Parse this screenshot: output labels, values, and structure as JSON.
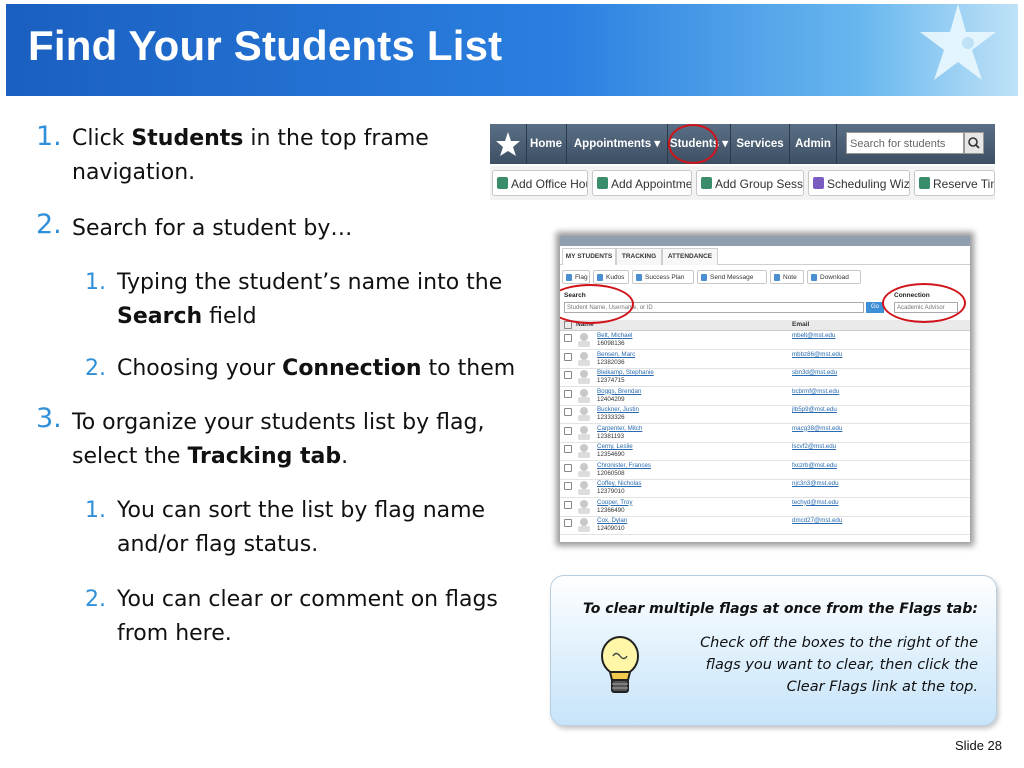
{
  "slide": {
    "title": "Find Your Students List",
    "number_label": "Slide 28"
  },
  "bullets": [
    {
      "num": "1.",
      "pre": "Click ",
      "bold": "Students",
      "post": " in the top frame",
      "line2": "navigation."
    },
    {
      "num": "2.",
      "text": "Search for a student by…"
    },
    {
      "num": "1.",
      "text": "Typing the student’s name into the",
      "bold": "Search",
      "post": " field"
    },
    {
      "num": "2.",
      "pre": "Choosing your ",
      "bold": "Connection",
      "post": " to them"
    },
    {
      "num": "3.",
      "text": "To organize your students list by flag,",
      "pre2": "select the ",
      "bold": "Tracking tab",
      "post": "."
    },
    {
      "num": "1.",
      "text": "You can sort the list by flag name",
      "line2": "and/or flag status."
    },
    {
      "num": "2.",
      "text": "You can clear or comment on flags",
      "line2": "from here."
    }
  ],
  "nav_screenshot": {
    "menu": [
      {
        "label": "Home"
      },
      {
        "label": "Appointments ▾"
      },
      {
        "label": "Students ▾"
      },
      {
        "label": "Services"
      },
      {
        "label": "Admin"
      }
    ],
    "search_placeholder": "Search for students",
    "toolbar": [
      {
        "label": "Add Office Hours"
      },
      {
        "label": "Add Appointment"
      },
      {
        "label": "Add Group Session"
      },
      {
        "label": "Scheduling Wizard"
      },
      {
        "label": "Reserve Time"
      }
    ]
  },
  "students_screenshot": {
    "tabs": [
      "MY STUDENTS",
      "TRACKING",
      "ATTENDANCE"
    ],
    "actions": [
      "Flag",
      "Kudos",
      "Success Plan",
      "Send Message",
      "Note",
      "Download"
    ],
    "search_label": "Search",
    "search_placeholder": "Student Name, Username, or ID",
    "go_label": "Go",
    "connection_label": "Connection",
    "connection_value": "Academic Advisor",
    "col_name": "Name",
    "col_email": "Email",
    "rows": [
      {
        "name": "Belt, Michael",
        "id": "16098136",
        "email": "mbelt@mst.edu"
      },
      {
        "name": "Bensen, Marc",
        "id": "12382036",
        "email": "mbbz86@mst.edu"
      },
      {
        "name": "Bleikamp, Stephanie",
        "id": "12374715",
        "email": "sbn3d@mst.edu"
      },
      {
        "name": "Boggs, Brendan",
        "id": "12404209",
        "email": "bcbrmf@mst.edu"
      },
      {
        "name": "Buckner, Justin",
        "id": "12333326",
        "email": "jlb5p9@mst.edu"
      },
      {
        "name": "Carpenter, Mitch",
        "id": "12381193",
        "email": "macg38@mst.edu"
      },
      {
        "name": "Cerny, Leslie",
        "id": "12354690",
        "email": "lscvf2@mst.edu"
      },
      {
        "name": "Chronister, Frances",
        "id": "12060508",
        "email": "fxczrb@mst.edu"
      },
      {
        "name": "Coffey, Nicholas",
        "id": "12379010",
        "email": "njc3n3@mst.edu"
      },
      {
        "name": "Cooper, Troy",
        "id": "12366490",
        "email": "techyd@mst.edu"
      },
      {
        "name": "Cox, Dylan",
        "id": "12409010",
        "email": "dmcd27@mst.edu"
      }
    ]
  },
  "tip": {
    "heading": "To clear multiple flags at once from the Flags tab:",
    "line1": "Check off the boxes to the right of the",
    "line2": "flags you want to clear, then click the",
    "line3": "Clear Flags link at the top."
  },
  "colors": {
    "accent_blue": "#2f8fd8",
    "highlight_ring": "#d0141a",
    "nav_bg": "#3d4f63"
  }
}
